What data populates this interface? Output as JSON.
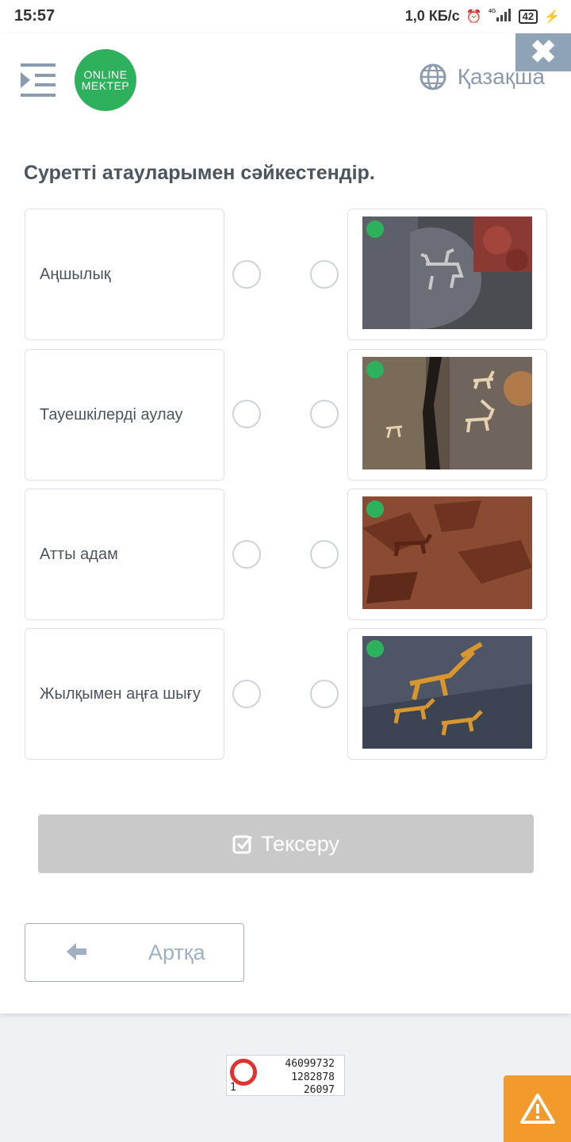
{
  "status_bar": {
    "time": "15:57",
    "speed": "1,0 КБ/с",
    "network": "4G",
    "battery": "42"
  },
  "header": {
    "logo_line1": "ONLINE",
    "logo_line2": "MEKTEP",
    "language": "Қазақша"
  },
  "question": "Суретті атауларымен сәйкестендір.",
  "labels": [
    "Аңшылық",
    "Тауешкілерді аулау",
    "Атты адам",
    "Жылқымен аңға шығу"
  ],
  "images": [
    {
      "icon": "petroglyph-rider-image"
    },
    {
      "icon": "petroglyph-ibex-image"
    },
    {
      "icon": "petroglyph-hunt-image"
    },
    {
      "icon": "petroglyph-horses-image"
    }
  ],
  "buttons": {
    "check": "Тексеру",
    "back": "Артқа"
  },
  "captcha": {
    "line1": "46099732",
    "line2": "1282878",
    "line3_left": "1",
    "line3_right": "26097"
  },
  "colors": {
    "logo_green": "#2eb15c",
    "close_bg": "#8fa3b6",
    "check_bg": "#c9c9c9",
    "warn_bg": "#f39a2c"
  }
}
